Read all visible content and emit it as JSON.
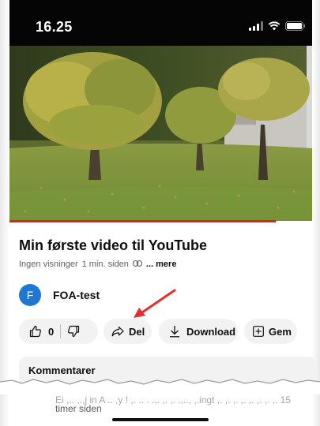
{
  "status_bar": {
    "time": "16.25",
    "icons": [
      "signal-icon",
      "wifi-icon",
      "battery-icon"
    ]
  },
  "video": {
    "progress": 0.88,
    "progress_color": "#e62117"
  },
  "info": {
    "title": "Min første video til YouTube",
    "views": "Ingen visninger",
    "age": "1 min. siden",
    "more": "... mere"
  },
  "channel": {
    "initial": "F",
    "name": "FOA-test",
    "avatar_color": "#1e78d2"
  },
  "actions": {
    "like_count": "0",
    "share_label": "Del",
    "download_label": "Download",
    "save_label": "Gem"
  },
  "comments": {
    "label": "Kommentarer"
  },
  "suggestion": {
    "line1": "Ei ,.. ,.,j in A .. ,y ! ,. .. . .,. ,. ,. .,.., ,.ingt ,. ,. ,. ,. ,. ,. ,. ,. 15",
    "line2": "timer siden"
  },
  "annotation": {
    "arrow_color": "#e03030"
  }
}
